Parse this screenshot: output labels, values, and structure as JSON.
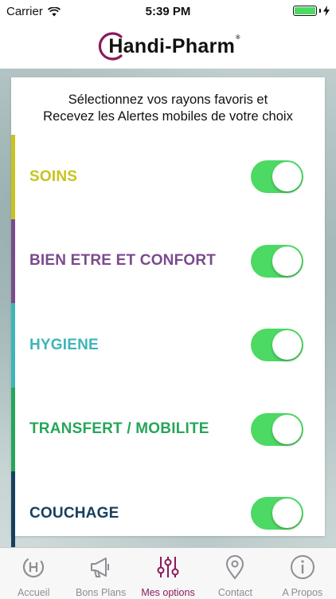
{
  "status_bar": {
    "carrier": "Carrier",
    "time": "5:39 PM",
    "battery_level": 1.0
  },
  "header": {
    "logo_text": "Handi-Pharm",
    "logo_mark": "®",
    "logo_accent_color": "#8b1a5a"
  },
  "intro": {
    "line1": "Sélectionnez vos rayons favoris et",
    "line2": "Recevez les Alertes mobiles de votre choix"
  },
  "categories": [
    {
      "label": "SOINS",
      "color": "#c9c31f",
      "enabled": true
    },
    {
      "label": "BIEN ETRE ET CONFORT",
      "color": "#7b4a8e",
      "enabled": true
    },
    {
      "label": "HYGIENE",
      "color": "#3fb5b8",
      "enabled": true
    },
    {
      "label": "TRANSFERT / MOBILITE",
      "color": "#27a55a",
      "enabled": true
    },
    {
      "label": "COUCHAGE",
      "color": "#173f5f",
      "enabled": true
    }
  ],
  "tabs": [
    {
      "label": "Accueil",
      "icon": "handi-pharm-h-icon",
      "active": false
    },
    {
      "label": "Bons Plans",
      "icon": "megaphone-icon",
      "active": false
    },
    {
      "label": "Mes options",
      "icon": "sliders-icon",
      "active": true
    },
    {
      "label": "Contact",
      "icon": "map-pin-icon",
      "active": false
    },
    {
      "label": "A Propos",
      "icon": "info-icon",
      "active": false
    }
  ],
  "colors": {
    "toggle_on": "#4cd964",
    "tab_active": "#8b1a5a",
    "tab_inactive": "#8e8e93"
  }
}
